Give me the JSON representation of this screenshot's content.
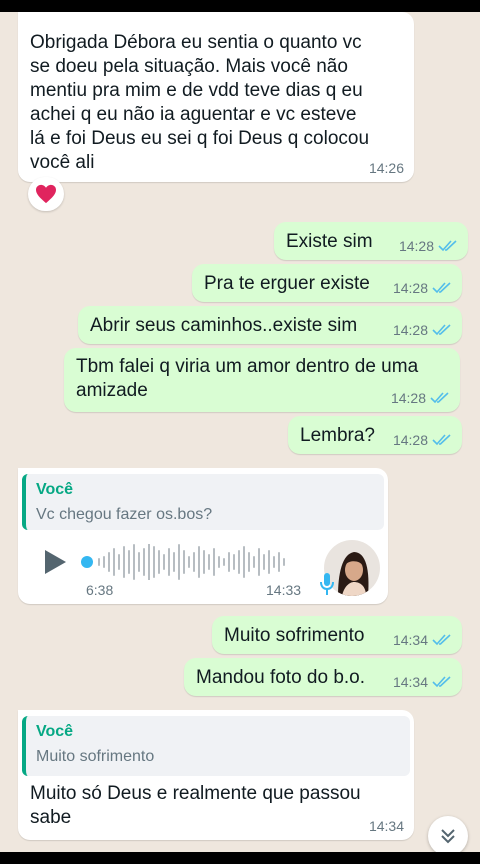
{
  "colors": {
    "chat_background": "#efe7de",
    "incoming_bubble": "#ffffff",
    "outgoing_bubble": "#d9fdd3",
    "read_ticks": "#53bdeb",
    "quote_accent": "#06a884",
    "voice_accent": "#34b7f1"
  },
  "messages": [
    {
      "direction": "incoming",
      "lines": [
        "Obrigada Débora eu sentia o quanto vc",
        "se doeu pela situação. Mais você não",
        "mentiu pra mim e de vdd teve dias q eu",
        "achei q eu não ia aguentar e vc esteve",
        "lá e foi Deus eu sei q foi Deus q colocou",
        "você ali"
      ],
      "time": "14:26",
      "reaction": "❤️"
    },
    {
      "direction": "outgoing",
      "text": "Existe sim",
      "time": "14:28",
      "status": "read"
    },
    {
      "direction": "outgoing",
      "text": "Pra te erguer existe",
      "time": "14:28",
      "status": "read"
    },
    {
      "direction": "outgoing",
      "text": "Abrir seus caminhos..existe sim",
      "time": "14:28",
      "status": "read"
    },
    {
      "direction": "outgoing",
      "lines": [
        "Tbm falei q viria um amor dentro de uma",
        "amizade"
      ],
      "time": "14:28",
      "status": "read"
    },
    {
      "direction": "outgoing",
      "text": "Lembra?",
      "time": "14:28",
      "status": "read"
    },
    {
      "direction": "incoming",
      "type": "voice",
      "quote": {
        "author": "Você",
        "text": "Vc chegou fazer os.bos?"
      },
      "duration": "6:38",
      "time": "14:33",
      "played_fraction": 0.0
    },
    {
      "direction": "outgoing",
      "text": "Muito sofrimento",
      "time": "14:34",
      "status": "read"
    },
    {
      "direction": "outgoing",
      "text": "Mandou foto do b.o.",
      "time": "14:34",
      "status": "read"
    },
    {
      "direction": "incoming",
      "quote": {
        "author": "Você",
        "text": "Muito sofrimento"
      },
      "lines": [
        "Muito só Deus e realmente que passou",
        "sabe"
      ],
      "time": "14:34"
    }
  ],
  "icons": {
    "reaction": "heart-icon",
    "read_receipt": "double-check-icon",
    "play": "play-icon",
    "mic": "mic-icon",
    "scroll_down": "double-chevron-down-icon"
  }
}
